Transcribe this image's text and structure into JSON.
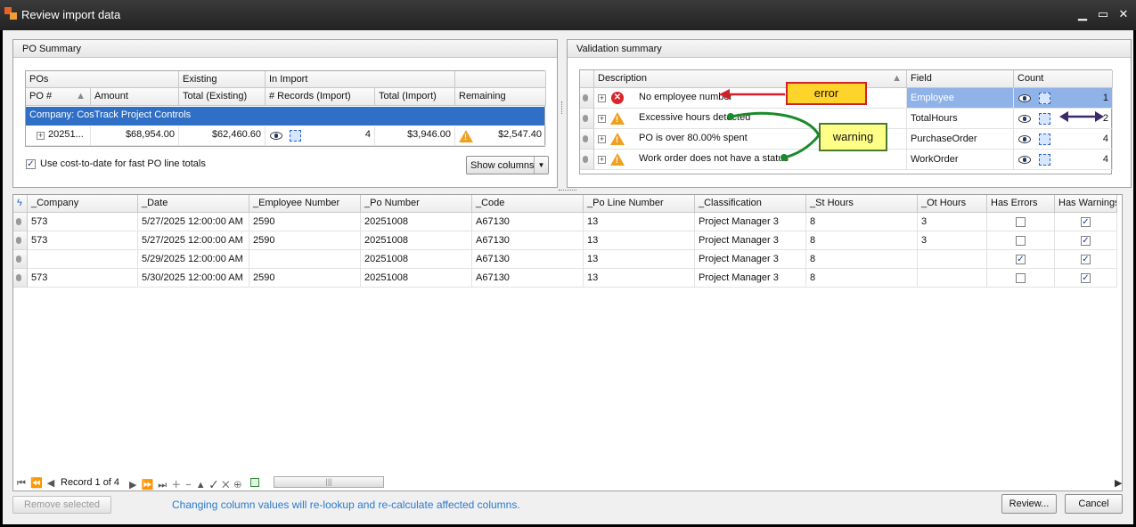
{
  "window": {
    "title": "Review import data"
  },
  "po_summary": {
    "title": "PO Summary",
    "band_headers": [
      "POs",
      "Existing",
      "In Import"
    ],
    "columns": [
      "PO #",
      "Amount",
      "Total (Existing)",
      "# Records (Import)",
      "Total (Import)",
      "Remaining"
    ],
    "group_label": "Company: CosTrack Project Controls",
    "row": {
      "po": "20251...",
      "amount": "$68,954.00",
      "total_existing": "$62,460.60",
      "records": "4",
      "total_import": "$3,946.00",
      "remaining": "$2,547.40"
    },
    "checkbox_label": "Use cost-to-date for fast PO line totals",
    "show_columns_label": "Show columns"
  },
  "validation": {
    "title": "Validation summary",
    "columns": [
      "Description",
      "Field",
      "Count"
    ],
    "rows": [
      {
        "desc": "No employee number",
        "field": "Employee",
        "count": "1",
        "type": "error"
      },
      {
        "desc": "Excessive hours detected",
        "field": "TotalHours",
        "count": "2",
        "type": "warning"
      },
      {
        "desc": "PO is over 80.00% spent",
        "field": "PurchaseOrder",
        "count": "4",
        "type": "warning"
      },
      {
        "desc": "Work order does not have a status",
        "field": "WorkOrder",
        "count": "4",
        "type": "warning"
      }
    ]
  },
  "callouts": {
    "error": "error",
    "warning": "warning"
  },
  "main_grid": {
    "columns": [
      "_Company",
      "_Date",
      "_Employee Number",
      "_Po Number",
      "_Code",
      "_Po Line Number",
      "_Classification",
      "_St Hours",
      "_Ot Hours",
      "Has Errors",
      "Has Warnings"
    ],
    "rows": [
      {
        "company": "573",
        "date": "5/27/2025 12:00:00 AM",
        "emp": "2590",
        "po": "20251008",
        "code": "A67130",
        "line": "13",
        "cls": "Project Manager 3",
        "st": "8",
        "ot": "3",
        "err": false,
        "warn": true
      },
      {
        "company": "573",
        "date": "5/27/2025 12:00:00 AM",
        "emp": "2590",
        "po": "20251008",
        "code": "A67130",
        "line": "13",
        "cls": "Project Manager 3",
        "st": "8",
        "ot": "3",
        "err": false,
        "warn": true
      },
      {
        "company": "",
        "date": "5/29/2025 12:00:00 AM",
        "emp": "",
        "po": "20251008",
        "code": "A67130",
        "line": "13",
        "cls": "Project Manager 3",
        "st": "8",
        "ot": "",
        "err": true,
        "warn": true
      },
      {
        "company": "573",
        "date": "5/30/2025 12:00:00 AM",
        "emp": "2590",
        "po": "20251008",
        "code": "A67130",
        "line": "13",
        "cls": "Project Manager 3",
        "st": "8",
        "ot": "",
        "err": false,
        "warn": true
      }
    ],
    "record_nav": "Record 1 of 4"
  },
  "footer": {
    "remove_label": "Remove selected",
    "hint": "Changing column values will re-lookup and re-calculate affected columns.",
    "review_label": "Review...",
    "cancel_label": "Cancel"
  },
  "colors": {
    "accent": "#2f6fc5",
    "hint": "#2a7ad0",
    "error": "#d9252a",
    "warning": "#f0a020"
  }
}
